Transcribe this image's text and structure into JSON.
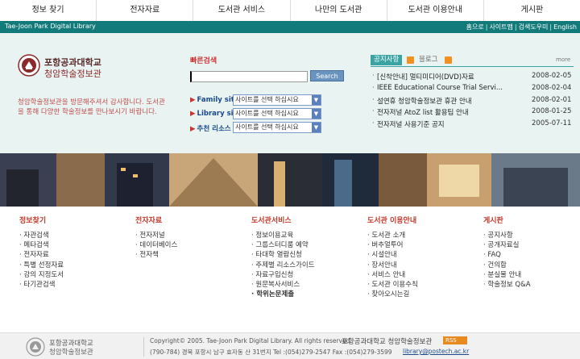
{
  "topnav": [
    "정보 찾기",
    "전자자료",
    "도서관 서비스",
    "나만의 도서관",
    "도서관 이용안내",
    "게시판"
  ],
  "titlebar": {
    "name": "Tae-Joon Park Digital Library",
    "util": [
      "홈으로",
      "사이트맵",
      "검색도우미",
      "English"
    ]
  },
  "logo": {
    "line1": "포항공과대학교",
    "line2": "청암학술정보관"
  },
  "welcome": "청암학술정보관을 방문해주셔서 감사합니다. 도서관을 통해 다양한 학술정보를 만나보시기 바랍니다.",
  "quick_search": {
    "title": "빠른검색",
    "input_value": "",
    "button": "Search",
    "rows": [
      {
        "label": "Family site",
        "select": "사이트를 선택 하십시요"
      },
      {
        "label": "Library site",
        "select": "사이트를 선택 하십시요"
      },
      {
        "label": "추천 리소스",
        "select": "사이트를 선택 하십시요"
      }
    ]
  },
  "notices": {
    "tab": "공지사항",
    "blog": "블로그",
    "more": "more",
    "items": [
      {
        "title": "[신착안내] 멀티미디어(DVD)자료",
        "date": "2008-02-05"
      },
      {
        "title": "IEEE Educational Course Trial Servi...",
        "date": "2008-02-04"
      },
      {
        "title": "설연휴 청암학술정보관 휴관 안내",
        "date": "2008-02-01"
      },
      {
        "title": "전자저널 AtoZ list 활용팁 안내",
        "date": "2008-01-25"
      },
      {
        "title": "전자저널 사용기준 공지",
        "date": "2005-07-11"
      }
    ]
  },
  "sitemap": [
    {
      "head": "정보찾기",
      "items": [
        "자관검색",
        "메타검색",
        "전자자료",
        "특별 선정자료",
        "강의 지정도서",
        "타기관검색"
      ]
    },
    {
      "head": "전자자료",
      "items": [
        "전자저널",
        "데이터베이스",
        "전자책"
      ]
    },
    {
      "head": "도서관서비스",
      "items": [
        "정보이용교육",
        "그룹스터디룸 예약",
        "타대학 열람신청",
        "주제별 리소스가이드",
        "자료구입신청",
        "원문복사서비스",
        "학위논문제출"
      ]
    },
    {
      "head": "도서관 이용안내",
      "items": [
        "도서관 소개",
        "버추얼투어",
        "시설안내",
        "장서안내",
        "서비스 안내",
        "도서관 이용수칙",
        "찾아오시는길"
      ]
    },
    {
      "head": "게시판",
      "items": [
        "공지사항",
        "공개자료실",
        "FAQ",
        "건의함",
        "분실물 안내",
        "학술정보 Q&A"
      ]
    }
  ],
  "footer": {
    "line1": "포항공과대학교",
    "line2": "청암학술정보관",
    "copyright": "Copyright© 2005. Tae-Joon Park Digital Library. All rights reserved.",
    "org": "포항공과대학교 청암학술정보관",
    "rss": "RSS",
    "address": "(790-784) 경북 포항시 남구 효자동 산 31번지 Tel :(054)279-2547 Fax :(054)279-3599",
    "email": "library@postech.ac.kr"
  }
}
